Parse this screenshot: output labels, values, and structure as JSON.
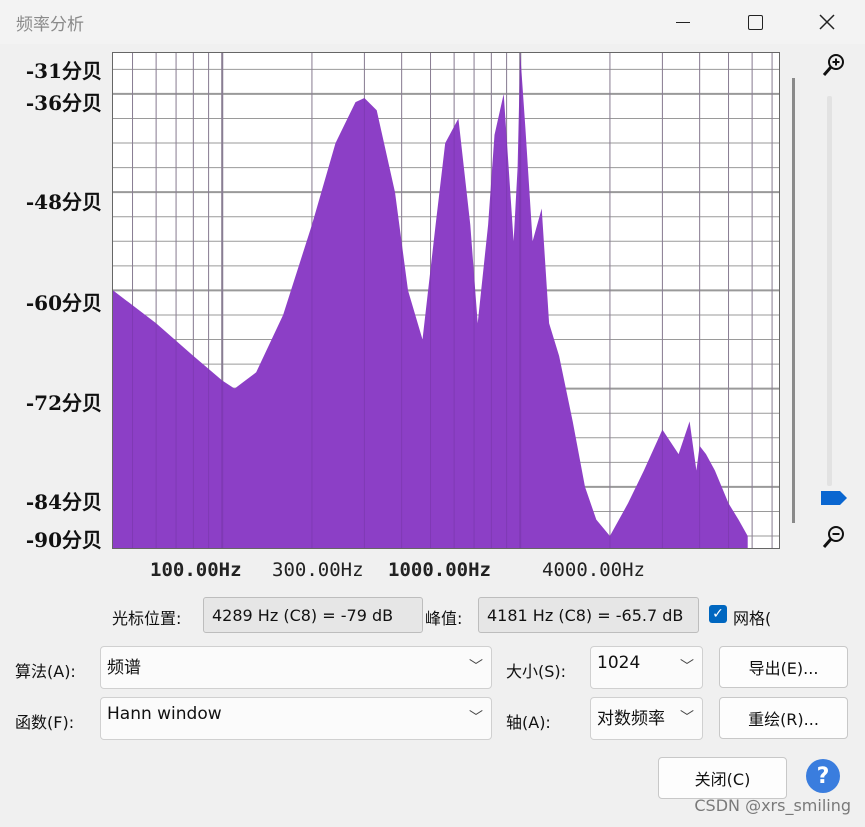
{
  "window": {
    "title": "频率分析",
    "minimize_icon": "minimize-icon",
    "maximize_icon": "maximize-icon",
    "close_icon": "close-icon"
  },
  "plot": {
    "y_ticks": [
      "-31分贝",
      "-36分贝",
      "-48分贝",
      "-60分贝",
      "-72分贝",
      "-84分贝",
      "-90分贝"
    ],
    "x_ticks": [
      "100.00Hz",
      "300.00Hz",
      "1000.00Hz",
      "4000.00Hz"
    ],
    "fill_color": "#8c3fc6",
    "grid_color": "#9a9a9a"
  },
  "chart_data": {
    "type": "area",
    "x_scale": "log",
    "xlabel": "",
    "ylabel": "",
    "ylim": [
      -90,
      -31
    ],
    "grid": true,
    "tick_labels_x": [
      "100.00Hz",
      "300.00Hz",
      "1000.00Hz",
      "4000.00Hz"
    ],
    "tick_labels_y": [
      "-31分贝",
      "-36分贝",
      "-48分贝",
      "-60分贝",
      "-72分贝",
      "-84分贝",
      "-90分贝"
    ],
    "series": [
      {
        "x": [
          43,
          60,
          80,
          100,
          110,
          130,
          160,
          200,
          240,
          280,
          300,
          330,
          380,
          420,
          470,
          520,
          560,
          620,
          680,
          720,
          780,
          820,
          880,
          950,
          980,
          1000,
          1040,
          1100,
          1180,
          1250,
          1350,
          1500,
          1650,
          1800,
          2000,
          2300,
          2600,
          3000,
          3400,
          3700,
          3900,
          4000,
          4200,
          4500,
          5000,
          5400,
          5800
        ],
        "values": [
          -60,
          -64,
          -68,
          -71,
          -72,
          -70,
          -63,
          -52,
          -42,
          -37,
          -36.5,
          -38,
          -48,
          -60,
          -66,
          -52,
          -42,
          -39,
          -52,
          -64,
          -52,
          -41,
          -36,
          -54,
          -45,
          -31,
          -40,
          -54,
          -50,
          -64,
          -68,
          -76,
          -84,
          -88,
          -90,
          -86,
          -82,
          -77,
          -80,
          -76,
          -82,
          -79,
          -80,
          -82,
          -86,
          -88,
          -90
        ]
      }
    ]
  },
  "readouts": {
    "cursor_label": "光标位置:",
    "cursor_value": "4289 Hz (C8) = -79 dB",
    "peak_label": "峰值:",
    "peak_value": "4181 Hz (C8) = -65.7 dB",
    "grid_label": "网格(",
    "grid_checked": true
  },
  "controls": {
    "algorithm_label": "算法(A):",
    "algorithm_value": "频谱",
    "size_label": "大小(S):",
    "size_value": "1024",
    "export_label": "导出(E)...",
    "function_label": "函数(F):",
    "function_value": "Hann window",
    "axis_label": "轴(A):",
    "axis_value": "对数频率",
    "replot_label": "重绘(R)...",
    "close_label": "关闭(C)",
    "help_label": "?"
  },
  "watermark": "CSDN @xrs_smiling"
}
